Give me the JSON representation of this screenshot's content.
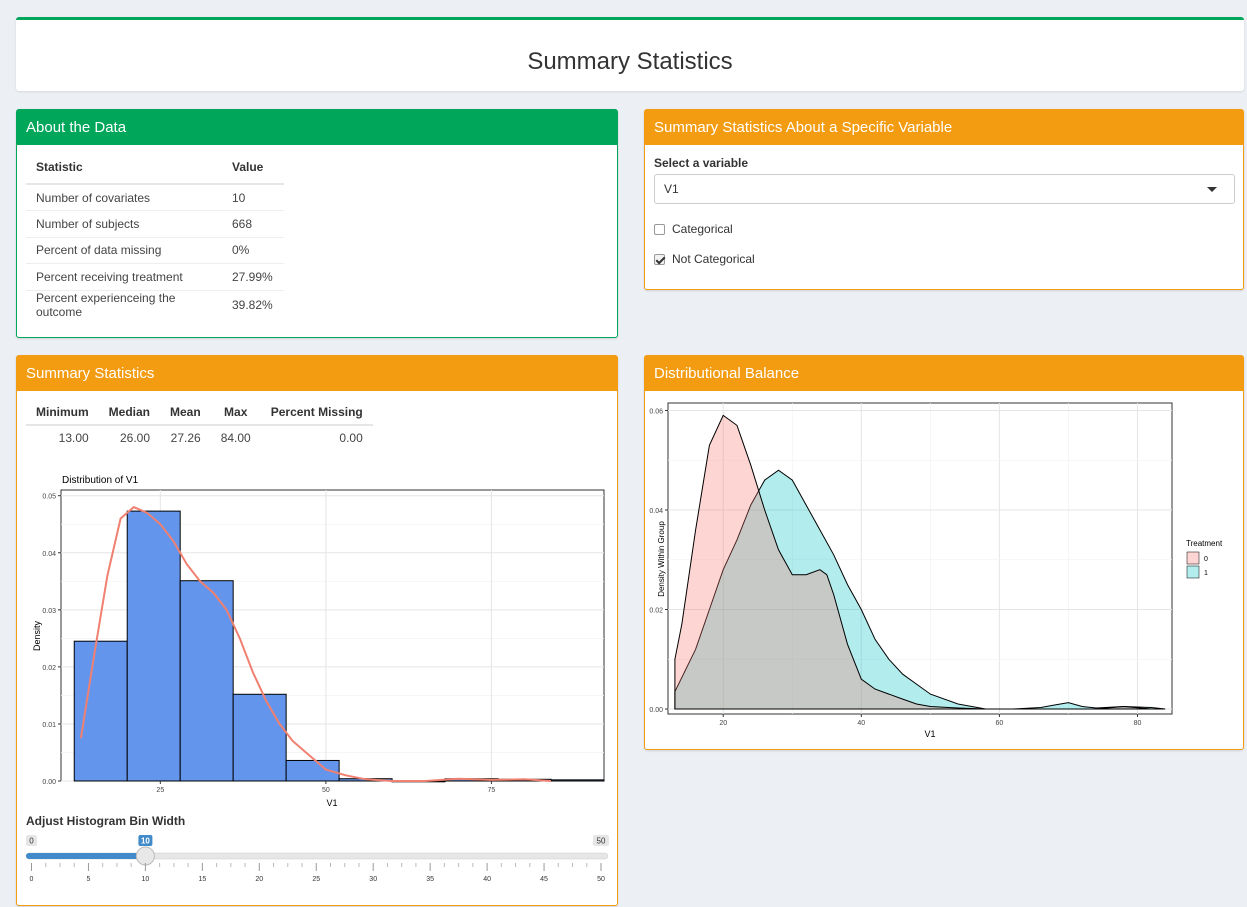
{
  "header": {
    "title": "Summary Statistics"
  },
  "about": {
    "title": "About the Data",
    "columns": [
      "Statistic",
      "Value"
    ],
    "rows": [
      {
        "label": "Number of covariates",
        "value": "10"
      },
      {
        "label": "Number of subjects",
        "value": "668"
      },
      {
        "label": "Percent of data missing",
        "value": "0%"
      },
      {
        "label": "Percent receiving treatment",
        "value": "27.99%"
      },
      {
        "label": "Percent experienceing the outcome",
        "value": "39.82%"
      }
    ]
  },
  "variable_panel": {
    "title": "Summary Statistics About a Specific Variable",
    "select_label": "Select a variable",
    "selected_value": "V1",
    "options": [
      {
        "label": "Categorical",
        "checked": false
      },
      {
        "label": "Not Categorical",
        "checked": true
      }
    ]
  },
  "summary": {
    "title": "Summary Statistics",
    "columns": [
      "Minimum",
      "Median",
      "Mean",
      "Max",
      "Percent Missing"
    ],
    "values": [
      "13.00",
      "26.00",
      "27.26",
      "84.00",
      "0.00"
    ]
  },
  "histogram": {
    "title": "Distribution of V1",
    "xlabel": "V1",
    "ylabel": "Density",
    "x_ticks": [
      "25",
      "50",
      "75"
    ],
    "y_ticks": [
      "0.00",
      "0.01",
      "0.02",
      "0.03",
      "0.04",
      "0.05"
    ]
  },
  "slider": {
    "label": "Adjust Histogram Bin Width",
    "min_label": "0",
    "max_label": "50",
    "value_label": "10",
    "value": 10,
    "ticks": [
      "0",
      "5",
      "10",
      "15",
      "20",
      "25",
      "30",
      "35",
      "40",
      "45",
      "50"
    ]
  },
  "balance": {
    "title": "Distributional Balance",
    "xlabel": "V1",
    "ylabel": "Density Within Group",
    "x_ticks": [
      "20",
      "40",
      "60",
      "80"
    ],
    "y_ticks": [
      "0.00",
      "0.02",
      "0.04",
      "0.06"
    ],
    "legend_title": "Treatment",
    "legend_items": [
      "0",
      "1"
    ]
  },
  "colors": {
    "green": "#00a65a",
    "orange": "#f39c12",
    "hist_fill": "#6495ed",
    "density_line": "#f08070",
    "group0": "#f8766d",
    "group1": "#00bfc4",
    "slider": "#428bca"
  },
  "chart_data": [
    {
      "type": "bar",
      "title": "Distribution of V1",
      "xlabel": "V1",
      "ylabel": "Density",
      "bin_width": 10,
      "xlim": [
        10,
        92
      ],
      "ylim": [
        0,
        0.051
      ],
      "bins": [
        {
          "x0": 12,
          "x1": 20,
          "value": 0.0245
        },
        {
          "x0": 20,
          "x1": 28,
          "value": 0.0473
        },
        {
          "x0": 28,
          "x1": 36,
          "value": 0.0351
        },
        {
          "x0": 36,
          "x1": 44,
          "value": 0.0152
        },
        {
          "x0": 44,
          "x1": 52,
          "value": 0.0036
        },
        {
          "x0": 52,
          "x1": 60,
          "value": 0.0004
        },
        {
          "x0": 60,
          "x1": 68,
          "value": 0.0
        },
        {
          "x0": 68,
          "x1": 76,
          "value": 0.0004
        },
        {
          "x0": 76,
          "x1": 84,
          "value": 0.0003
        },
        {
          "x0": 84,
          "x1": 92,
          "value": 0.0002
        }
      ],
      "density_curve": {
        "x": [
          13,
          15,
          17,
          19,
          21,
          23,
          25,
          27,
          29,
          31,
          33,
          35,
          37,
          39,
          41,
          43,
          45,
          47,
          50,
          53,
          56,
          60,
          65,
          70,
          75,
          80,
          84
        ],
        "y": [
          0.0075,
          0.022,
          0.036,
          0.046,
          0.048,
          0.047,
          0.045,
          0.042,
          0.038,
          0.035,
          0.033,
          0.03,
          0.025,
          0.019,
          0.014,
          0.01,
          0.007,
          0.005,
          0.002,
          0.001,
          0.0003,
          0.0,
          0.0,
          0.0004,
          0.0002,
          0.0003,
          0.0
        ]
      }
    },
    {
      "type": "area",
      "xlabel": "V1",
      "ylabel": "Density Within Group",
      "xlim": [
        12,
        85
      ],
      "ylim": [
        -0.001,
        0.0615
      ],
      "legend_title": "Treatment",
      "legend_position": "right",
      "series": [
        {
          "name": "0",
          "x": [
            13,
            14,
            16,
            18,
            20,
            22,
            24,
            26,
            28,
            30,
            32,
            34,
            35,
            36,
            38,
            40,
            42,
            44,
            46,
            48,
            50,
            54,
            58,
            62,
            66,
            70,
            74,
            78,
            82,
            84
          ],
          "y": [
            0.01,
            0.017,
            0.036,
            0.053,
            0.059,
            0.057,
            0.049,
            0.04,
            0.032,
            0.027,
            0.027,
            0.028,
            0.027,
            0.023,
            0.013,
            0.006,
            0.004,
            0.003,
            0.002,
            0.001,
            0.0005,
            0.0002,
            0.0,
            0.0,
            0.0,
            0.0,
            0.0,
            0.0005,
            0.0,
            0.0
          ]
        },
        {
          "name": "1",
          "x": [
            13,
            16,
            18,
            20,
            22,
            24,
            26,
            28,
            30,
            32,
            34,
            36,
            38,
            40,
            42,
            44,
            46,
            48,
            50,
            54,
            58,
            62,
            66,
            68,
            70,
            72,
            74,
            78,
            82,
            84
          ],
          "y": [
            0.0035,
            0.012,
            0.02,
            0.028,
            0.034,
            0.041,
            0.046,
            0.048,
            0.046,
            0.041,
            0.036,
            0.031,
            0.025,
            0.02,
            0.014,
            0.01,
            0.007,
            0.005,
            0.003,
            0.001,
            0.0,
            0.0,
            0.0003,
            0.0008,
            0.0013,
            0.0005,
            0.0002,
            0.0005,
            0.0003,
            0.0
          ]
        }
      ]
    }
  ]
}
